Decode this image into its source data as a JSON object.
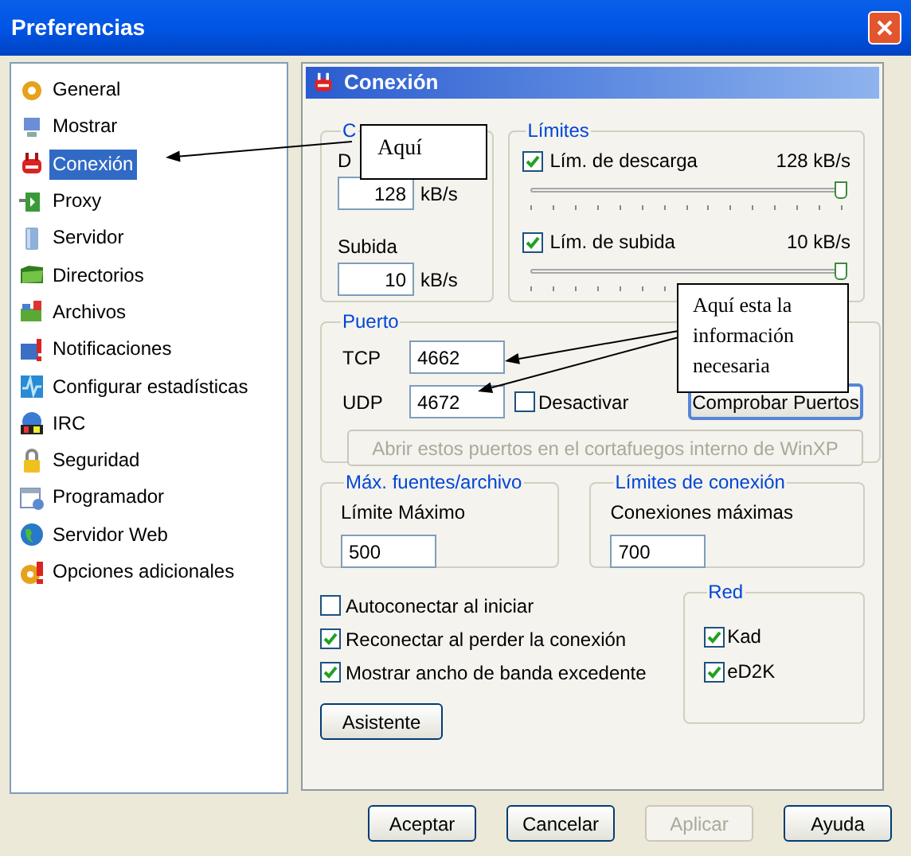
{
  "window": {
    "title": "Preferencias"
  },
  "sidebar": {
    "items": [
      {
        "label": "General",
        "selected": false
      },
      {
        "label": "Mostrar",
        "selected": false
      },
      {
        "label": "Conexión",
        "selected": true
      },
      {
        "label": "Proxy",
        "selected": false
      },
      {
        "label": "Servidor",
        "selected": false
      },
      {
        "label": "Directorios",
        "selected": false
      },
      {
        "label": "Archivos",
        "selected": false
      },
      {
        "label": "Notificaciones",
        "selected": false
      },
      {
        "label": "Configurar estadísticas",
        "selected": false
      },
      {
        "label": "IRC",
        "selected": false
      },
      {
        "label": "Seguridad",
        "selected": false
      },
      {
        "label": "Programador",
        "selected": false
      },
      {
        "label": "Servidor Web",
        "selected": false
      },
      {
        "label": "Opciones adicionales",
        "selected": false
      }
    ]
  },
  "panel": {
    "title": "Conexión"
  },
  "capacity": {
    "title": "C",
    "download_label": "D",
    "download_value": "128",
    "download_unit": "kB/s",
    "upload_label": "Subida",
    "upload_value": "10",
    "upload_unit": "kB/s"
  },
  "limits": {
    "title": "Límites",
    "sliders": [
      {
        "label": "Lím. de descarga",
        "checked": true,
        "reading": "128 kB/s",
        "level": 0.98
      },
      {
        "label": "Lím. de subida",
        "checked": true,
        "reading": "10 kB/s",
        "level": 0.98
      }
    ]
  },
  "port": {
    "title": "Puerto",
    "tcp_label": "TCP",
    "tcp_value": "4662",
    "udp_label": "UDP",
    "udp_value": "4672",
    "disable": {
      "label": "Desactivar",
      "checked": false
    },
    "check_button": "Comprobar Puertos",
    "firewall_button": {
      "label": "Abrir estos puertos en el cortafuegos interno de WinXP",
      "disabled": true
    }
  },
  "max_sources": {
    "title": "Máx. fuentes/archivo",
    "label": "Límite Máximo",
    "value": "500"
  },
  "connection_limits": {
    "title": "Límites de conexión",
    "label": "Conexiones máximas",
    "value": "700"
  },
  "options": [
    {
      "label": "Autoconectar al iniciar",
      "checked": false
    },
    {
      "label": "Reconectar al perder la conexión",
      "checked": true
    },
    {
      "label": "Mostrar ancho de banda excedente",
      "checked": true
    }
  ],
  "wizard_button": "Asistente",
  "network": {
    "title": "Red",
    "items": [
      {
        "label": "Kad",
        "checked": true
      },
      {
        "label": "eD2K",
        "checked": true
      }
    ]
  },
  "buttons": [
    {
      "label": "Aceptar",
      "disabled": false
    },
    {
      "label": "Cancelar",
      "disabled": false
    },
    {
      "label": "Aplicar",
      "disabled": true
    },
    {
      "label": "Ayuda",
      "disabled": false
    }
  ],
  "annotations": [
    {
      "text": "Aquí"
    },
    {
      "text": "Aquí esta la información necesaria"
    }
  ]
}
